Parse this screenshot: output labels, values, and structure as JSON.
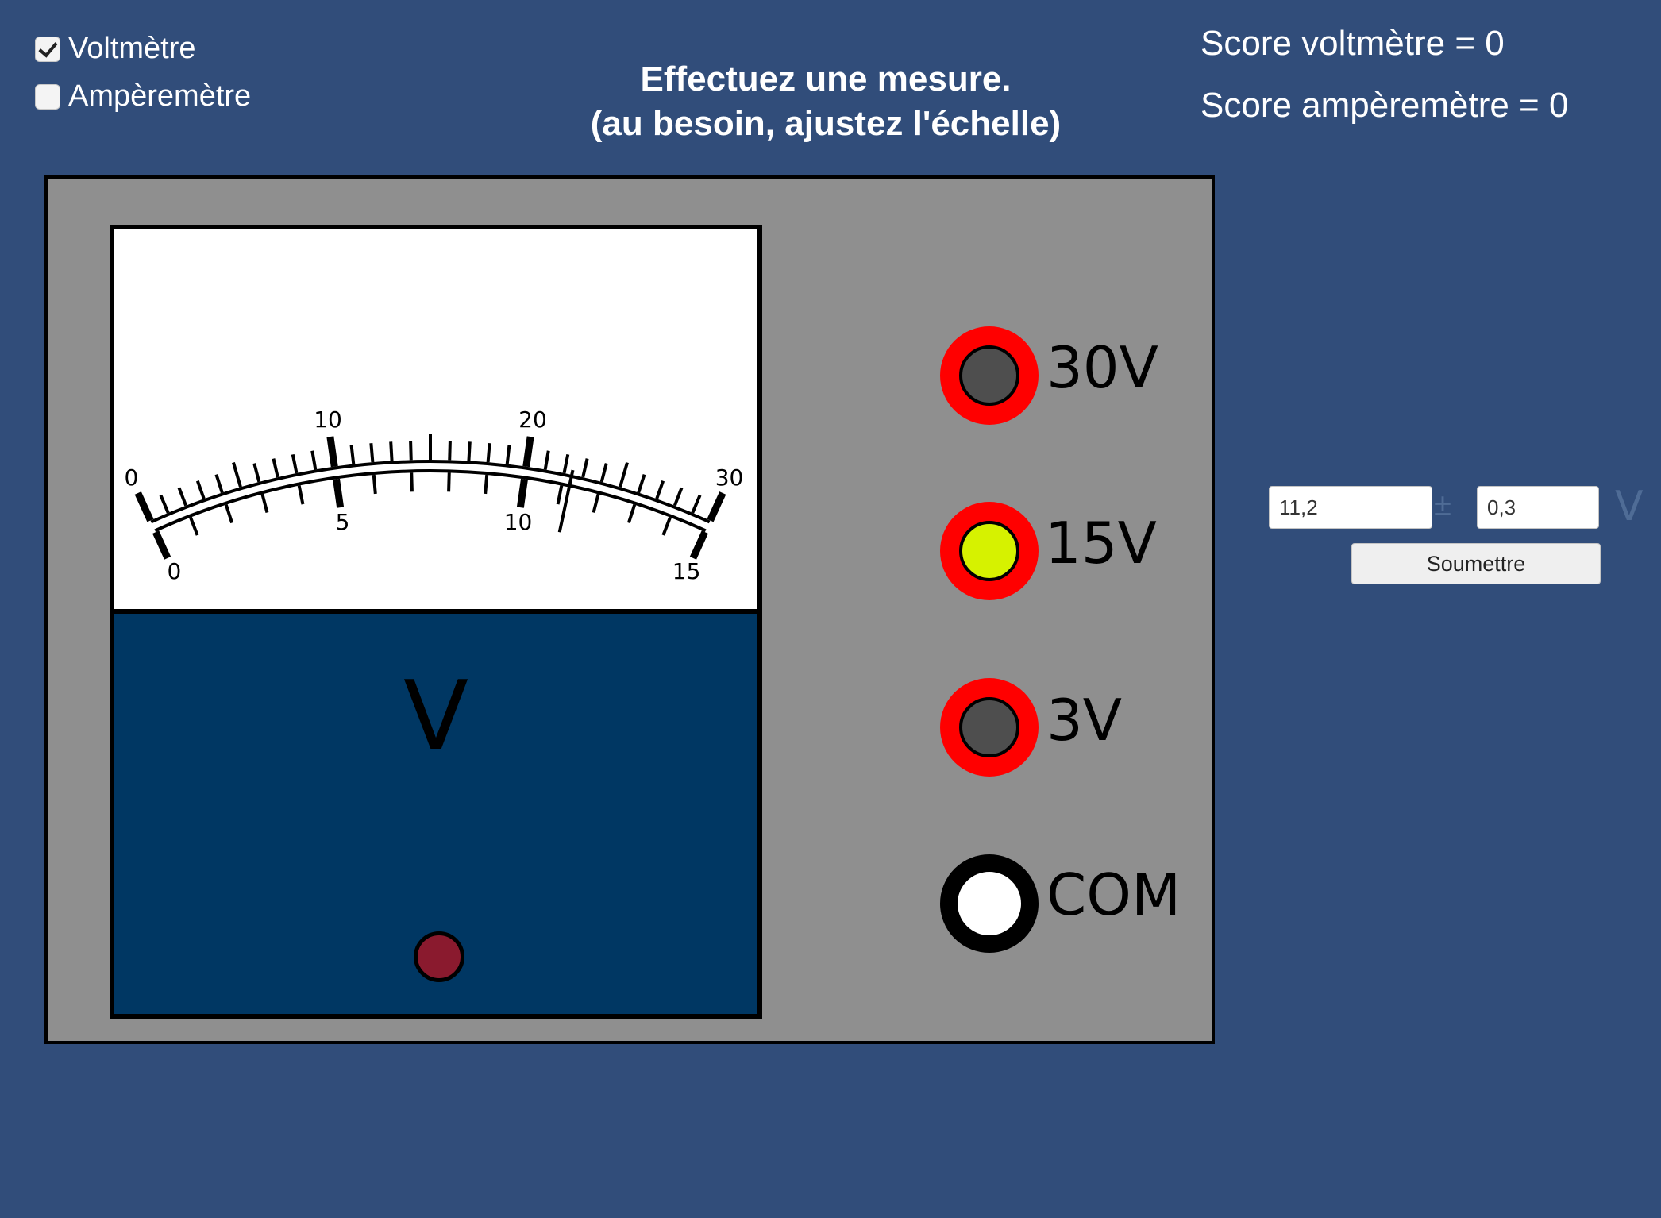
{
  "modes": [
    {
      "label": "Voltmètre",
      "checked": true
    },
    {
      "label": "Ampèremètre",
      "checked": false
    }
  ],
  "instructions": {
    "line1": "Effectuez une mesure.",
    "line2": "(au besoin, ajustez l'échelle)"
  },
  "scores": {
    "voltmeter": "Score voltmètre = 0",
    "ammeter": "Score ampèremètre = 0"
  },
  "meter": {
    "unit_symbol": "V",
    "outer_scale": {
      "labels": [
        "0",
        "10",
        "20",
        "30"
      ],
      "max": 30
    },
    "inner_scale": {
      "labels": [
        "0",
        "5",
        "10",
        "15"
      ],
      "max": 15
    },
    "needle_fraction": 0.747
  },
  "terminals": [
    {
      "label": "30V",
      "active": false
    },
    {
      "label": "15V",
      "active": true
    },
    {
      "label": "3V",
      "active": false
    },
    {
      "label": "COM",
      "active": false
    }
  ],
  "answer": {
    "value": "11,2",
    "plus_minus": "±",
    "uncertainty": "0,3",
    "unit": "V",
    "submit_label": "Soumettre"
  },
  "colors": {
    "background": "#314d7a",
    "panel": "#8f8f8f",
    "lower_panel": "#003763",
    "terminal_ring": "#ff0000",
    "terminal_active": "#d6f200",
    "knob": "#8a1a2e"
  }
}
